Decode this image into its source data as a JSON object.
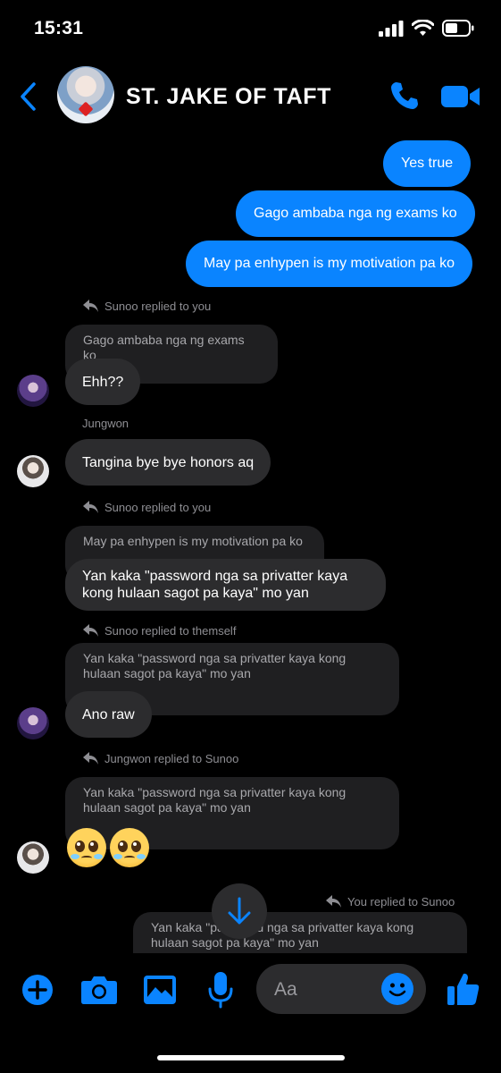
{
  "status_bar": {
    "time": "15:31"
  },
  "header": {
    "title": "ST. JAKE OF TAFT",
    "icons": [
      "back-icon",
      "phone-icon",
      "video-camera-icon"
    ]
  },
  "messages": {
    "out_1": "Yes true",
    "out_2": "Gago ambaba nga ng exams ko",
    "out_3": "May pa enhypen is my motivation pa ko",
    "reply_1_label": "Sunoo replied to you",
    "reply_1_quote": "Gago ambaba nga ng exams ko",
    "reply_1_text": "Ehh??",
    "sender_jungwon": "Jungwon",
    "jungwon_text": "Tangina bye bye honors aq",
    "reply_2_label": "Sunoo replied to you",
    "reply_2_quote": "May pa enhypen is my motivation pa ko",
    "reply_2_text_line1": "Yan kaka \"password nga sa privatter kaya",
    "reply_2_text_line2": "kong hulaan sagot pa kaya\" mo yan",
    "reply_3_label": "Sunoo replied to themself",
    "reply_3_quote_line1": "Yan kaka \"password nga sa privatter kaya kong",
    "reply_3_quote_line2": "hulaan sagot pa kaya\" mo yan",
    "reply_3_text": "Ano raw",
    "reply_4_label": "Jungwon replied to Sunoo",
    "reply_4_quote_line1": "Yan kaka \"password nga sa privatter kaya kong",
    "reply_4_quote_line2": "hulaan sagot pa kaya\" mo yan",
    "reply_4_emoji": "pleading-face-emoji x2",
    "reply_5_label": "You replied to Sunoo",
    "reply_5_quote_line1": "Yan kaka \"password nga sa privatter kaya kong",
    "reply_5_quote_line2": "hulaan sagot pa kaya\" mo yan"
  },
  "composer": {
    "placeholder": "Aa",
    "icons": [
      "plus-icon",
      "camera-icon",
      "image-icon",
      "microphone-icon",
      "emoji-icon",
      "thumbs-up-icon"
    ]
  },
  "colors": {
    "accent": "#0a84ff",
    "background": "#000000",
    "incoming_bubble": "#2c2c2e",
    "quoted_bubble": "#1f1f21"
  }
}
